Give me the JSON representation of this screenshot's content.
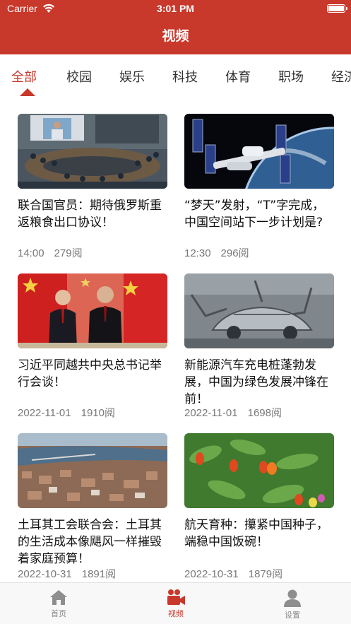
{
  "status_bar": {
    "carrier": "Carrier",
    "time": "3:01 PM"
  },
  "header": {
    "title": "视频"
  },
  "tabs": [
    {
      "label": "全部",
      "active": true
    },
    {
      "label": "校园"
    },
    {
      "label": "娱乐"
    },
    {
      "label": "科技"
    },
    {
      "label": "体育"
    },
    {
      "label": "职场"
    },
    {
      "label": "经济"
    }
  ],
  "videos": [
    {
      "title": "联合国官员：期待俄罗斯重返粮食出口协议！",
      "time": "14:00",
      "views": "279阅",
      "thumb": "un-meeting"
    },
    {
      "title": "“梦天”发射，“T”字完成，中国空间站下一步计划是?",
      "time": "12:30",
      "views": "296阅",
      "thumb": "space-station"
    },
    {
      "title": "习近平同越共中央总书记举行会谈！",
      "time": "2022-11-01",
      "views": "1910阅",
      "thumb": "leaders-flags"
    },
    {
      "title": "新能源汽车充电桩蓬勃发展，中国为绿色发展冲锋在前！",
      "time": "2022-11-01",
      "views": "1698阅",
      "thumb": "car-factory"
    },
    {
      "title": "土耳其工会联合会：土耳其的生活成本像飓风一样摧毁着家庭预算！",
      "time": "2022-10-31",
      "views": "1891阅",
      "thumb": "city-aerial"
    },
    {
      "title": "航天育种：攥紧中国种子，端稳中国饭碗！",
      "time": "2022-10-31",
      "views": "1879阅",
      "thumb": "pepper-plants"
    }
  ],
  "tabbar": [
    {
      "label": "首页",
      "icon": "home-icon"
    },
    {
      "label": "视频",
      "icon": "video-camera-icon",
      "active": true
    },
    {
      "label": "设置",
      "icon": "person-icon"
    }
  ],
  "colors": {
    "accent": "#c8382b",
    "meta": "#777777",
    "tabbar_bg": "#f8f8f8"
  }
}
